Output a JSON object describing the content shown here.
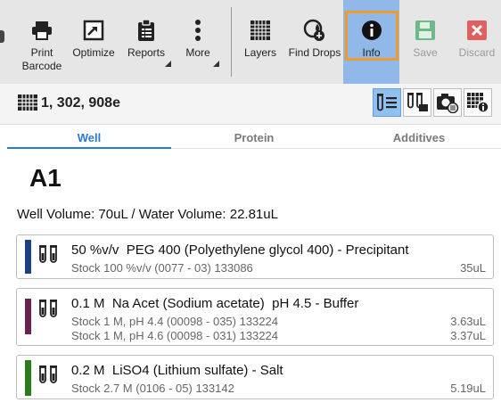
{
  "toolbar": {
    "print_barcode": [
      "Print",
      "Barcode"
    ],
    "optimize": "Optimize",
    "reports": "Reports",
    "more": "More",
    "layers": "Layers",
    "find_drops": "Find Drops",
    "info": "Info",
    "save": "Save",
    "discard": "Discard"
  },
  "plate": {
    "id": "1, 302, 908e"
  },
  "tabs": [
    "Well",
    "Protein",
    "Additives"
  ],
  "well": {
    "name": "A1",
    "volume_text": "Well Volume: 70uL / Water Volume: 22.81uL"
  },
  "ingredients": [
    {
      "color": "#1f3f86",
      "title": "50 %v/v  PEG 400 (Polyethylene glycol 400) - Precipitant",
      "stocks": [
        {
          "text": "Stock 100 %v/v (0077 - 03) 133086",
          "amount": "35uL"
        }
      ]
    },
    {
      "color": "#6b2251",
      "title": "0.1 M  Na Acet (Sodium acetate)  pH 4.5 - Buffer",
      "stocks": [
        {
          "text": "Stock 1 M, pH 4.4 (00098 - 035) 133224",
          "amount": "3.63uL"
        },
        {
          "text": "Stock 1 M, pH 4.6 (00098 - 031) 133224",
          "amount": "3.37uL"
        }
      ]
    },
    {
      "color": "#2b7a1c",
      "title": "0.2 M  LiSO4 (Lithium sulfate) - Salt",
      "stocks": [
        {
          "text": "Stock 2.7 M (0106 - 05) 133142",
          "amount": "5.19uL"
        }
      ]
    }
  ],
  "colors": {
    "accent": "#2a7bd0",
    "info_bg": "#90b8e8",
    "info_frame": "#f09b2c",
    "discard": "#e06060",
    "save": "#6fb88a"
  }
}
